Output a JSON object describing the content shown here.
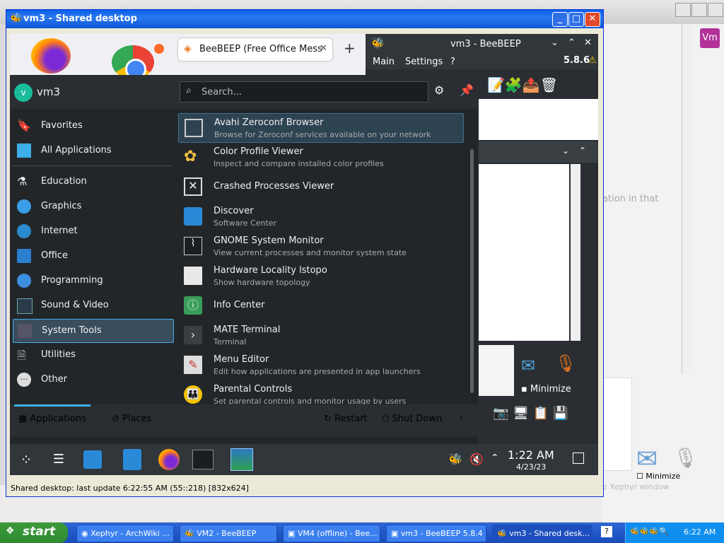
{
  "xp_window": {
    "title": "vm3 - Shared desktop",
    "status": "Shared desktop: last update 6:22:55 AM (55::218) [832x624]"
  },
  "host": {
    "vm_button": "Vm",
    "bg_text": "ation in that",
    "minimize_label": "Minimize",
    "xephyr_text": "e Xephyr window"
  },
  "firefox": {
    "tab_title": "BeeBEEP (Free Office Mess"
  },
  "beebeep": {
    "title": "vm3 - BeeBEEP",
    "menu": [
      "Main",
      "Settings",
      "?"
    ],
    "version": "5.8.6",
    "minimize_label": "Minimize"
  },
  "kmenu": {
    "user": "vm3",
    "avatar_letter": "v",
    "search_placeholder": "Search...",
    "categories": [
      {
        "label": "Favorites"
      },
      {
        "label": "All Applications"
      },
      {
        "label": "Education"
      },
      {
        "label": "Graphics"
      },
      {
        "label": "Internet"
      },
      {
        "label": "Office"
      },
      {
        "label": "Programming"
      },
      {
        "label": "Sound & Video"
      },
      {
        "label": "System Tools"
      },
      {
        "label": "Utilities"
      },
      {
        "label": "Other"
      }
    ],
    "apps": [
      {
        "name": "Avahi Zeroconf Browser",
        "desc": "Browse for Zeroconf services available on your network"
      },
      {
        "name": "Color Profile Viewer",
        "desc": "Inspect and compare installed color profiles"
      },
      {
        "name": "Crashed Processes Viewer",
        "desc": ""
      },
      {
        "name": "Discover",
        "desc": "Software Center"
      },
      {
        "name": "GNOME System Monitor",
        "desc": "View current processes and monitor system state"
      },
      {
        "name": "Hardware Locality lstopo",
        "desc": "Show hardware topology"
      },
      {
        "name": "Info Center",
        "desc": ""
      },
      {
        "name": "MATE Terminal",
        "desc": "Terminal"
      },
      {
        "name": "Menu Editor",
        "desc": "Edit how applications are presented in app launchers"
      },
      {
        "name": "Parental Controls",
        "desc": "Set parental controls and monitor usage by users"
      }
    ],
    "footer": {
      "applications": "Applications",
      "places": "Places",
      "restart": "Restart",
      "shutdown": "Shut Down"
    }
  },
  "kde_taskbar": {
    "time": "1:22 AM",
    "date": "4/23/23"
  },
  "xp_taskbar": {
    "start": "start",
    "items": [
      "Xephyr - ArchWiki ...",
      "VM2 - BeeBEEP",
      "VM4 (offline) - Bee...",
      "vm3 - BeeBEEP 5.8.4",
      "vm3 - Shared desk..."
    ],
    "clock": "6:22 AM"
  }
}
